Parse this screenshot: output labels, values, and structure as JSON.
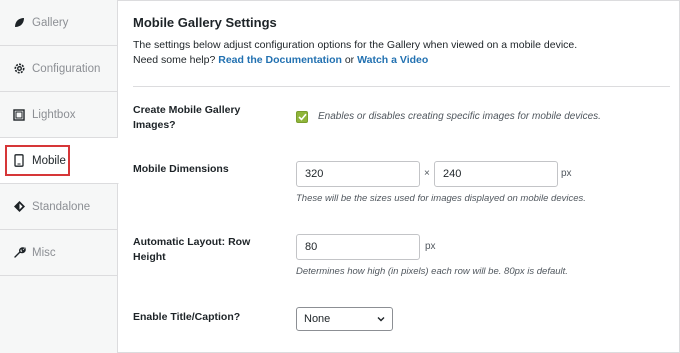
{
  "sidebar": {
    "items": [
      {
        "label": "Gallery",
        "icon": "leaf-icon"
      },
      {
        "label": "Configuration",
        "icon": "gear-icon"
      },
      {
        "label": "Lightbox",
        "icon": "lightbox-icon"
      },
      {
        "label": "Mobile",
        "icon": "mobile-icon",
        "active": true
      },
      {
        "label": "Standalone",
        "icon": "diamond-icon"
      },
      {
        "label": "Misc",
        "icon": "wrench-icon"
      }
    ]
  },
  "settings": {
    "title": "Mobile Gallery Settings",
    "description": "The settings below adjust configuration options for the Gallery when viewed on a mobile device.",
    "help_prefix": "Need some help?",
    "doc_link": "Read the Documentation",
    "help_or": "or",
    "video_link": "Watch a Video"
  },
  "fields": {
    "create_images": {
      "label_line1": "Create Mobile Gallery",
      "label_line2": "Images?",
      "checked": true,
      "help": "Enables or disables creating specific images for mobile devices."
    },
    "dimensions": {
      "label": "Mobile Dimensions",
      "width": "320",
      "separator": "×",
      "height": "240",
      "unit": "px",
      "help": "These will be the sizes used for images displayed on mobile devices."
    },
    "row_height": {
      "label_line1": "Automatic Layout: Row",
      "label_line2": "Height",
      "value": "80",
      "unit": "px",
      "help": "Determines how high (in pixels) each row will be. 80px is default."
    },
    "title_caption": {
      "label": "Enable Title/Caption?",
      "selected": "None"
    }
  },
  "colors": {
    "accent_link": "#2271b1",
    "checkbox": "#8fb53a",
    "highlight": "#d63638"
  }
}
